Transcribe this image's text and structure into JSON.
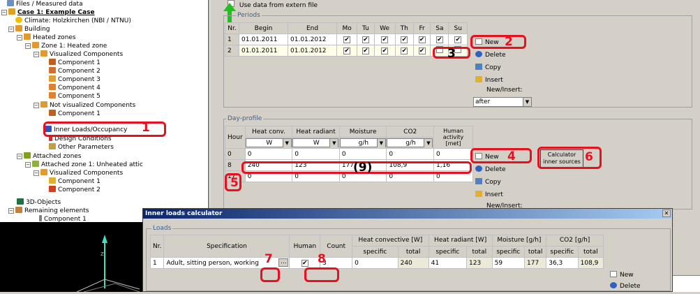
{
  "tree": {
    "items": [
      {
        "label": "Files / Measured data"
      },
      {
        "label": "Case 1: Example Case"
      },
      {
        "label": "Climate: Holzkirchen (NBI / NTNU)"
      },
      {
        "label": "Building"
      },
      {
        "label": "Heated zones"
      },
      {
        "label": "Zone 1: Heated zone"
      },
      {
        "label": "Visualized Components"
      },
      {
        "label": "Component 1"
      },
      {
        "label": "Component 2"
      },
      {
        "label": "Component 3"
      },
      {
        "label": "Component 4"
      },
      {
        "label": "Component 5"
      },
      {
        "label": "Not visualized Components"
      },
      {
        "label": "Component 1"
      },
      {
        "label": "Inner Loads/Occupancy"
      },
      {
        "label": "Design Conditions"
      },
      {
        "label": "Other Parameters"
      },
      {
        "label": "Attached zones"
      },
      {
        "label": "Attached zone 1: Unheated attic"
      },
      {
        "label": "Visualized Components"
      },
      {
        "label": "Component 1"
      },
      {
        "label": "Component 2"
      },
      {
        "label": "3D-Objects"
      },
      {
        "label": "Remaining elements"
      },
      {
        "label": "Component 1"
      }
    ]
  },
  "periods": {
    "use_extern_label": "Use data from extern file",
    "group_title": "Periods",
    "headers": [
      "Nr.",
      "Begin",
      "End",
      "Mo",
      "Tu",
      "We",
      "Th",
      "Fr",
      "Sa",
      "Su"
    ],
    "rows": [
      {
        "nr": "1",
        "begin": "01.01.2011",
        "end": "01.01.2012",
        "days": [
          true,
          true,
          true,
          true,
          true,
          true,
          true
        ]
      },
      {
        "nr": "2",
        "begin": "01.01.2011",
        "end": "01.01.2012",
        "days": [
          true,
          true,
          true,
          true,
          true,
          false,
          false
        ]
      }
    ],
    "buttons": {
      "new": "New",
      "delete": "Delete",
      "copy": "Copy",
      "insert": "Insert"
    },
    "new_insert_label": "New/Insert:",
    "new_insert_value": "after"
  },
  "day_profile": {
    "group_title": "Day-profile",
    "headers": [
      "Hour",
      "Heat conv.",
      "Heat radiant",
      "Moisture",
      "CO2",
      "Human activity [met]"
    ],
    "units": [
      "W",
      "W",
      "g/h",
      "g/h"
    ],
    "rows": [
      [
        "0",
        "0",
        "0",
        "0",
        "0",
        "0"
      ],
      [
        "8",
        "240",
        "123",
        "177",
        "108,9",
        "1,16"
      ],
      [
        "17",
        "0",
        "0",
        "0",
        "0",
        "0"
      ]
    ],
    "buttons": {
      "new": "New",
      "delete": "Delete",
      "copy": "Copy",
      "insert": "Insert"
    },
    "new_insert_label": "New/Insert:",
    "calc_button": "Calculator inner sources"
  },
  "dialog": {
    "title": "Inner loads calculator",
    "group_title": "Loads",
    "headers": {
      "nr": "Nr.",
      "spec": "Specification",
      "human": "Human",
      "count": "Count",
      "heat_conv": "Heat convective [W]",
      "heat_rad": "Heat radiant [W]",
      "moisture": "Moisture [g/h]",
      "co2": "CO2 [g/h]",
      "specific": "specific",
      "total": "total"
    },
    "row": {
      "nr": "1",
      "spec": "Adult, sitting person, working",
      "ellipsis": "...",
      "human": true,
      "count": "3",
      "hc_spec": "0",
      "hc_total": "240",
      "hr_spec": "41",
      "hr_total": "123",
      "m_spec": "59",
      "m_total": "177",
      "co2_spec": "36,3",
      "co2_total": "108,9"
    },
    "buttons": {
      "new": "New",
      "delete": "Delete"
    },
    "close": "✕"
  },
  "annotations": {
    "n1": "1",
    "n2": "2",
    "n3": "3",
    "n4": "4",
    "n5": "5",
    "n6": "6",
    "n7": "7",
    "n8": "8",
    "n9": "(9)"
  },
  "colors": {
    "highlight": "#e8101e",
    "group_title": "#3a5f8f",
    "title_bar": "#0a246a"
  }
}
